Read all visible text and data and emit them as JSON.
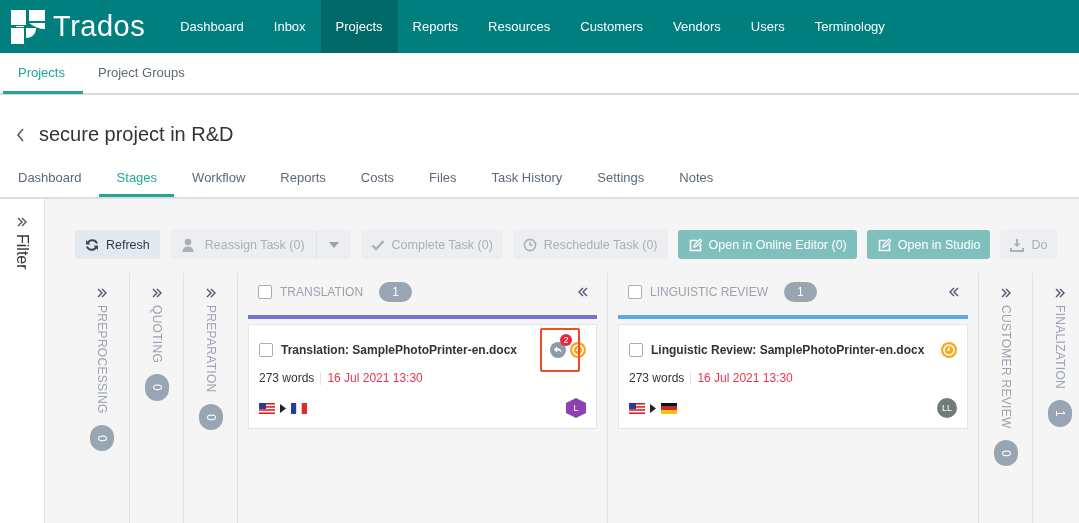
{
  "top_nav": {
    "logo": "Trados",
    "items": [
      {
        "label": "Dashboard",
        "selected": false
      },
      {
        "label": "Inbox",
        "selected": false
      },
      {
        "label": "Projects",
        "selected": true
      },
      {
        "label": "Reports",
        "selected": false
      },
      {
        "label": "Resources",
        "selected": false
      },
      {
        "label": "Customers",
        "selected": false
      },
      {
        "label": "Vendors",
        "selected": false
      },
      {
        "label": "Users",
        "selected": false
      },
      {
        "label": "Terminology",
        "selected": false
      }
    ]
  },
  "sub_nav": {
    "tabs": [
      {
        "label": "Projects",
        "selected": true
      },
      {
        "label": "Project Groups",
        "selected": false
      }
    ]
  },
  "project": {
    "title": "secure project in R&D"
  },
  "project_tabs": [
    {
      "label": "Dashboard",
      "selected": false
    },
    {
      "label": "Stages",
      "selected": true
    },
    {
      "label": "Workflow",
      "selected": false
    },
    {
      "label": "Reports",
      "selected": false
    },
    {
      "label": "Costs",
      "selected": false
    },
    {
      "label": "Files",
      "selected": false
    },
    {
      "label": "Task History",
      "selected": false
    },
    {
      "label": "Settings",
      "selected": false
    },
    {
      "label": "Notes",
      "selected": false
    }
  ],
  "filter": {
    "label": "Filter",
    "expanded": false
  },
  "toolbar": {
    "buttons": [
      {
        "kind": "refresh",
        "label": "Refresh",
        "disabled": false
      },
      {
        "kind": "reassign",
        "label": "Reassign Task (0)",
        "disabled": true
      },
      {
        "kind": "complete",
        "label": "Complete Task (0)",
        "disabled": true
      },
      {
        "kind": "reschedule",
        "label": "Reschedule Task (0)",
        "disabled": true
      },
      {
        "kind": "editor",
        "label": "Open in Online Editor (0)",
        "disabled": true
      },
      {
        "kind": "studio",
        "label": "Open in Studio",
        "disabled": true
      },
      {
        "kind": "download",
        "label": "Do",
        "disabled": true
      }
    ]
  },
  "stages": [
    {
      "kind": "collapsed",
      "name": "PREPROCESSING",
      "count": "0"
    },
    {
      "kind": "collapsed",
      "name": "QUOTING",
      "count": "0"
    },
    {
      "kind": "collapsed",
      "name": "PREPARATION",
      "count": "0"
    },
    {
      "kind": "expanded",
      "name": "TRANSLATION",
      "count": "1",
      "checked": false,
      "color": "#7272d9",
      "cards": [
        {
          "kind": "translation",
          "title": "Translation: SamplePhotoPrinter-en.docx",
          "checked": false,
          "comments": "2",
          "highlighted": true,
          "words": "273 words",
          "due": "16 Jul 2021 13:30",
          "assignee": {
            "initials": "L",
            "color": "#8e3fb0"
          }
        }
      ]
    },
    {
      "kind": "expanded",
      "name": "LINGUISTIC REVIEW",
      "count": "1",
      "checked": false,
      "color": "#5aaaea",
      "cards": [
        {
          "kind": "review",
          "title": "Linguistic Review: SamplePhotoPrinter-en.docx",
          "checked": false,
          "highlighted": false,
          "words": "273 words",
          "due": "16 Jul 2021 13:30",
          "assignee": {
            "initials": "LL",
            "color": "#6e7d77"
          }
        }
      ]
    },
    {
      "kind": "collapsed",
      "name": "CUSTOMER REVIEW",
      "count": "0"
    },
    {
      "kind": "collapsed",
      "name": "FINALIZATION",
      "count": "1"
    }
  ]
}
